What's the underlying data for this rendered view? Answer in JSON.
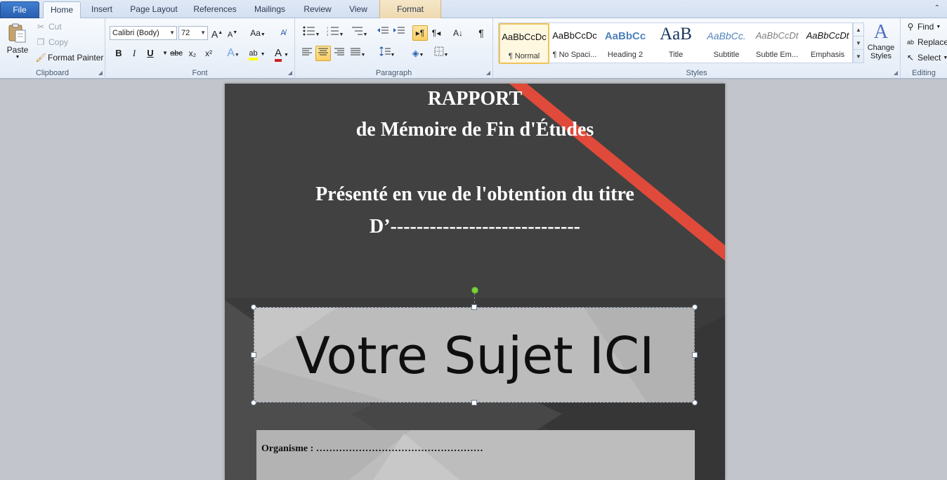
{
  "tabs": {
    "file": "File",
    "home": "Home",
    "insert": "Insert",
    "page_layout": "Page Layout",
    "references": "References",
    "mailings": "Mailings",
    "review": "Review",
    "view": "View",
    "format": "Format"
  },
  "clipboard": {
    "paste": "Paste",
    "cut": "Cut",
    "copy": "Copy",
    "format_painter": "Format Painter",
    "label": "Clipboard"
  },
  "font": {
    "name": "Calibri (Body)",
    "size": "72",
    "label": "Font",
    "bold": "B",
    "italic": "I",
    "underline": "U",
    "strike": "abc",
    "subscript": "x₂",
    "superscript": "x²",
    "grow": "A",
    "shrink": "A",
    "change_case": "Aa",
    "font_color": "A",
    "highlight": "ab"
  },
  "paragraph": {
    "label": "Paragraph"
  },
  "styles": {
    "label": "Styles",
    "items": [
      {
        "preview": "AaBbCcDc",
        "name": "¶ Normal"
      },
      {
        "preview": "AaBbCcDc",
        "name": "¶ No Spaci..."
      },
      {
        "preview": "AaBbCc",
        "name": "Heading 2"
      },
      {
        "preview": "AaB",
        "name": "Title"
      },
      {
        "preview": "AaBbCc.",
        "name": "Subtitle"
      },
      {
        "preview": "AaBbCcDt",
        "name": "Subtle Em..."
      },
      {
        "preview": "AaBbCcDt",
        "name": "Emphasis"
      }
    ],
    "change_styles": "Change Styles"
  },
  "editing": {
    "label": "Editing",
    "find": "Find",
    "replace": "Replace",
    "select": "Select"
  },
  "colors": {
    "accent_red": "#e04a3a",
    "page_dark": "#404040",
    "box_gray": "#bcbcbc"
  },
  "document": {
    "line1": "RAPPORT",
    "line2": "de Mémoire de Fin d'Études",
    "line3": "Présenté en vue de l'obtention  du titre",
    "line4": "D’-----------------------------",
    "subject": "Votre Sujet ICI",
    "organisme": "Organisme : ……………………………………………"
  }
}
